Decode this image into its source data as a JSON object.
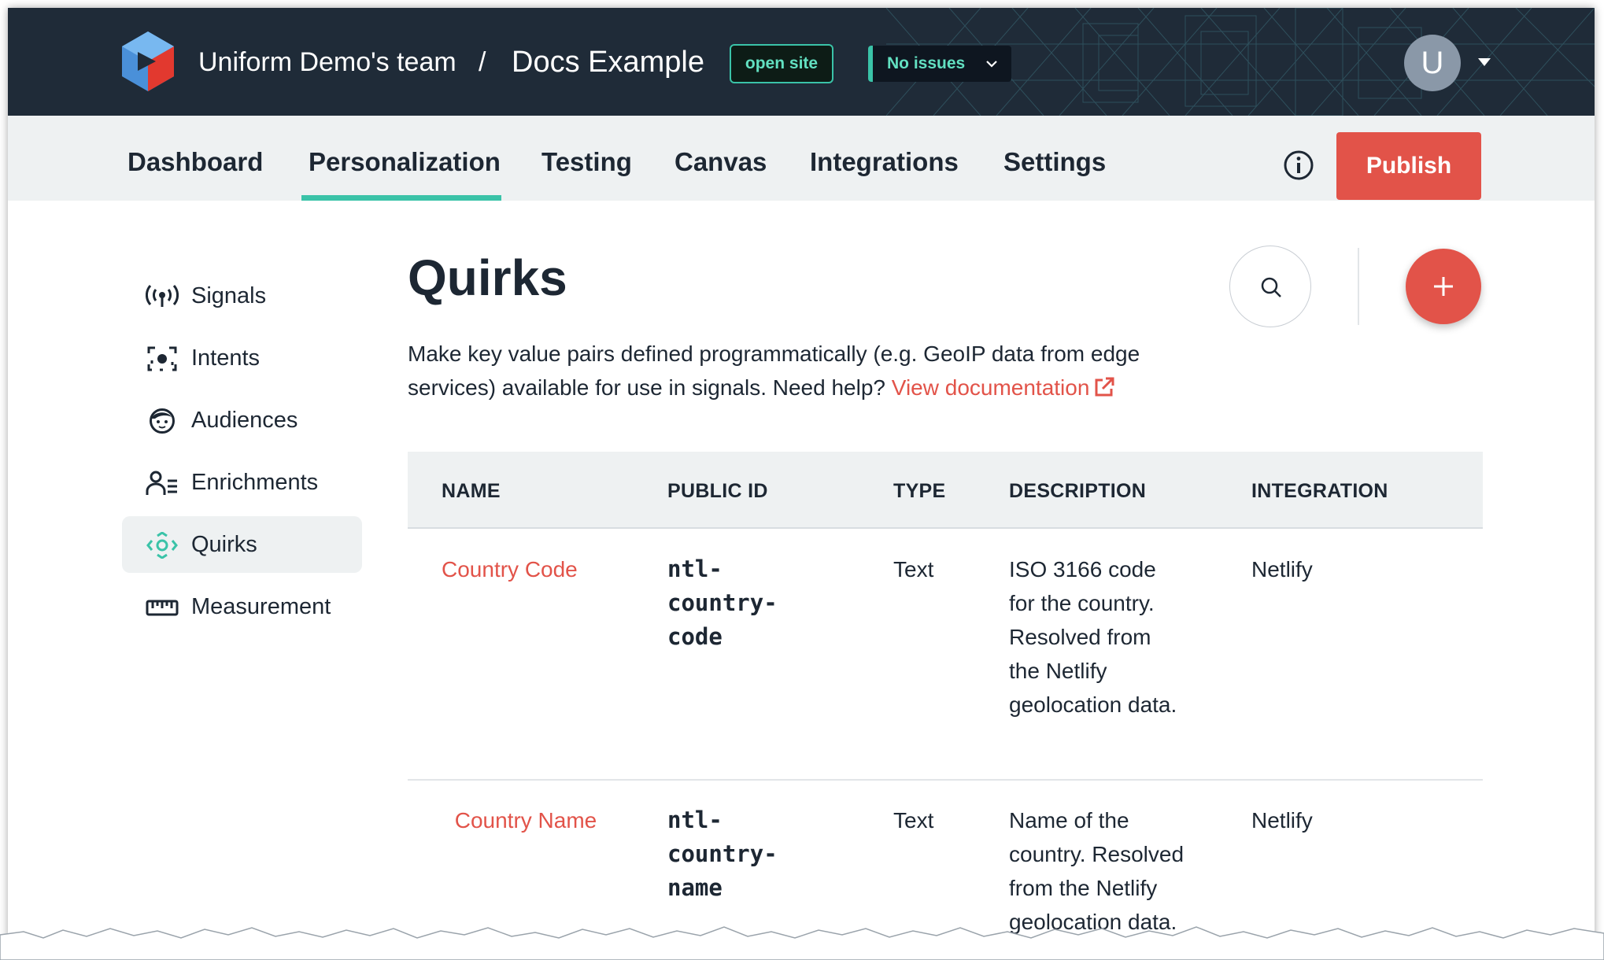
{
  "header": {
    "team_name": "Uniform Demo's team",
    "separator": "/",
    "project_name": "Docs Example",
    "open_site_label": "open site",
    "issues_label": "No issues",
    "avatar_letter": "U"
  },
  "nav": {
    "items": [
      "Dashboard",
      "Personalization",
      "Testing",
      "Canvas",
      "Integrations",
      "Settings"
    ],
    "active": "Personalization",
    "publish_label": "Publish"
  },
  "sidebar": {
    "items": [
      {
        "label": "Signals",
        "icon": "signal-icon"
      },
      {
        "label": "Intents",
        "icon": "intent-icon"
      },
      {
        "label": "Audiences",
        "icon": "audience-icon"
      },
      {
        "label": "Enrichments",
        "icon": "enrichment-icon"
      },
      {
        "label": "Quirks",
        "icon": "quirk-icon"
      },
      {
        "label": "Measurement",
        "icon": "ruler-icon"
      }
    ],
    "active": "Quirks"
  },
  "main": {
    "title": "Quirks",
    "description": "Make key value pairs defined programmatically (e.g. GeoIP data from edge services) available for use in signals. Need help?",
    "doc_link": "View documentation"
  },
  "table": {
    "headers": [
      "NAME",
      "PUBLIC ID",
      "TYPE",
      "DESCRIPTION",
      "INTEGRATION"
    ],
    "rows": [
      {
        "name": "Country Code",
        "public_id": "ntl-country-code",
        "type": "Text",
        "description": "ISO 3166 code for the country. Resolved from the Netlify geolocation data.",
        "integration": "Netlify"
      },
      {
        "name": "Country Name",
        "public_id": "ntl-country-name",
        "type": "Text",
        "description": "Name of the country. Resolved from the Netlify geolocation data.",
        "integration": "Netlify"
      }
    ]
  },
  "colors": {
    "accent": "#e25349",
    "teal": "#3ac3a8",
    "topbar": "#1f2b38",
    "nav_bg": "#eef1f2"
  }
}
